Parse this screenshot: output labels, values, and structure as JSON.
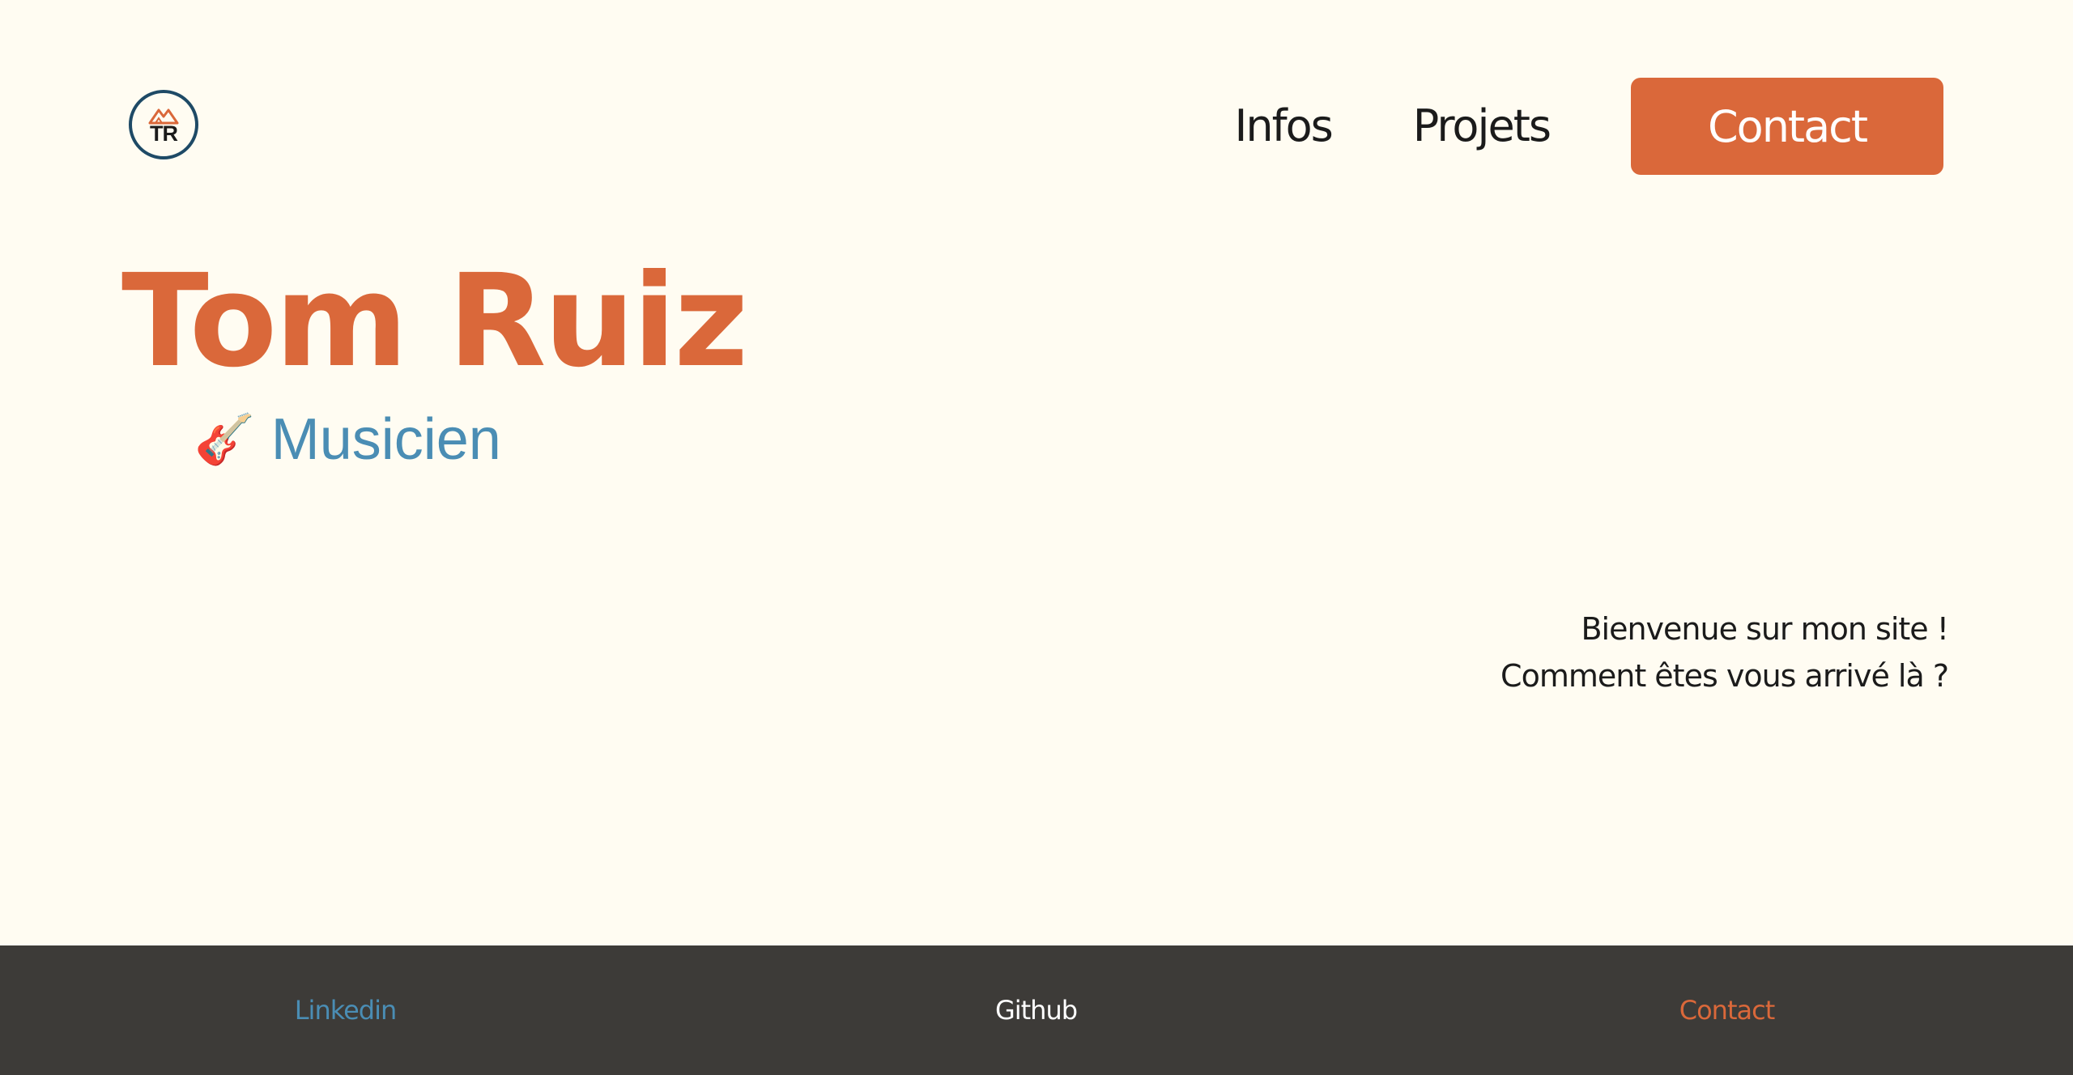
{
  "colors": {
    "background": "#fffcf2",
    "accent": "#da683a",
    "secondary": "#4a8db4",
    "text": "#1b1b1b",
    "footer_bg": "#3d3b38",
    "logo_border": "#1e4a66"
  },
  "header": {
    "logo_text": "TR",
    "logo_icon": "mountain-icon",
    "nav": {
      "infos": "Infos",
      "projets": "Projets",
      "contact": "Contact"
    }
  },
  "hero": {
    "name": "Tom Ruiz",
    "role_icon": "🎸",
    "role": "Musicien"
  },
  "welcome": {
    "line1": "Bienvenue sur mon site !",
    "line2": "Comment êtes vous arrivé là ?"
  },
  "footer": {
    "linkedin": "Linkedin",
    "github": "Github",
    "contact": "Contact"
  }
}
